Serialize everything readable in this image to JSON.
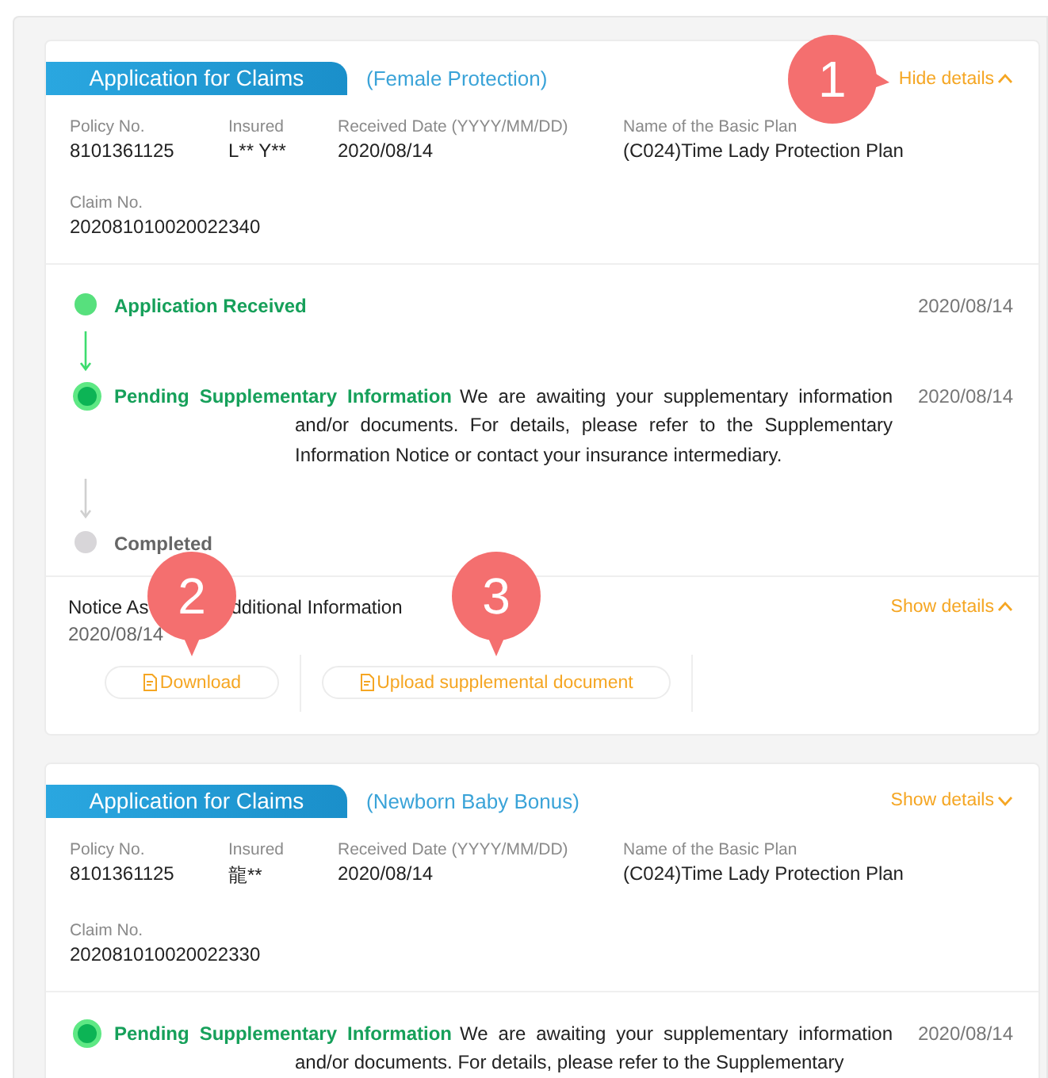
{
  "claims": [
    {
      "tag": "Application for Claims",
      "category": "(Female Protection)",
      "toggle": {
        "label": "Hide details",
        "expanded": true,
        "callout": "1"
      },
      "fields": [
        {
          "label": "Policy No.",
          "value": "8101361125"
        },
        {
          "label": "Insured",
          "value": "L** Y**"
        },
        {
          "label": "Received Date (YYYY/MM/DD)",
          "value": "2020/08/14"
        },
        {
          "label": "Name of the Basic Plan",
          "value": "(C024)Time Lady Protection Plan"
        },
        {
          "label": "Claim No.",
          "value": "202081010020022340"
        }
      ],
      "steps": [
        {
          "title": "Application Received",
          "kind": "done",
          "date": "2020/08/14"
        },
        {
          "title": "Pending Supplementary Information",
          "kind": "current",
          "description": "We are awaiting your supplementary information and/or documents. For details, please refer to the Supplementary Information Notice or contact your insurance intermediary.",
          "date": "2020/08/14"
        },
        {
          "title": "Completed",
          "kind": "pending"
        }
      ],
      "notice": {
        "title_parts": [
          "Notice As",
          "dditional Information"
        ],
        "date": "2020/08/14",
        "toggle": {
          "label": "Show details",
          "expanded": true
        },
        "buttons": [
          {
            "label": "Download",
            "callout": "2"
          },
          {
            "label": "Upload supplemental document",
            "callout": "3"
          }
        ]
      }
    },
    {
      "tag": "Application for Claims",
      "category": "(Newborn Baby Bonus)",
      "toggle": {
        "label": "Show details",
        "expanded": false
      },
      "fields": [
        {
          "label": "Policy No.",
          "value": "8101361125"
        },
        {
          "label": "Insured",
          "value": "龍**"
        },
        {
          "label": "Received Date (YYYY/MM/DD)",
          "value": "2020/08/14"
        },
        {
          "label": "Name of the Basic Plan",
          "value": "(C024)Time Lady Protection Plan"
        },
        {
          "label": "Claim No.",
          "value": "202081010020022330"
        }
      ],
      "steps": [
        {
          "title": "Pending Supplementary Information",
          "kind": "current",
          "description": "We are awaiting your supplementary information and/or documents. For details, please refer to the Supplementary",
          "date": "2020/08/14"
        }
      ]
    }
  ]
}
